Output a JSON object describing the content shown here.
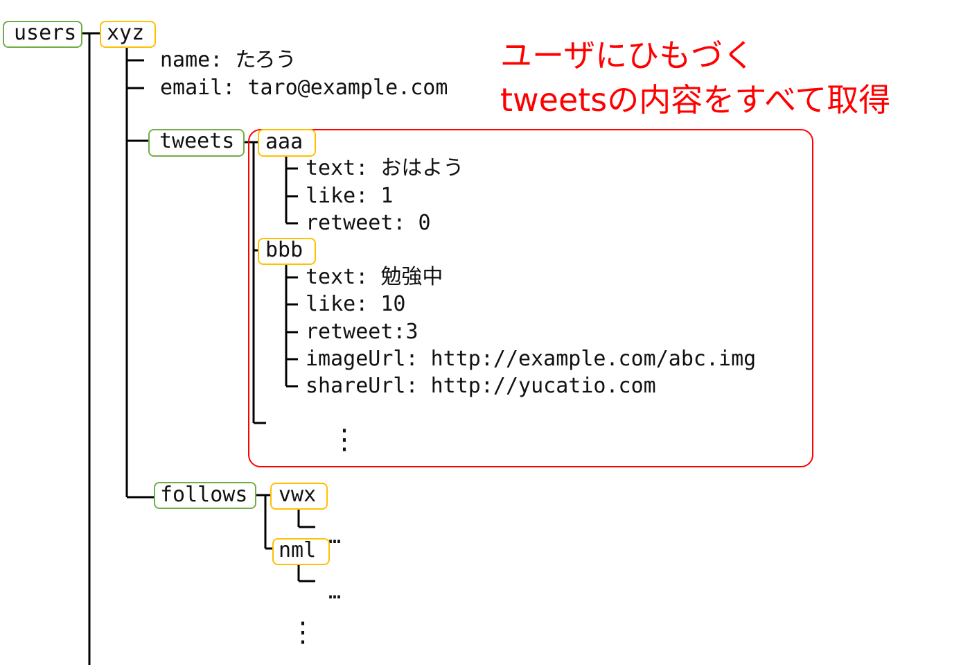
{
  "colors": {
    "collection": "#70ad47",
    "document": "#ffc000",
    "highlight": "#ff0000"
  },
  "annotation": {
    "line1": "ユーザにひもづく",
    "line2": "tweetsの内容をすべて取得"
  },
  "tree": {
    "users": "users",
    "xyz": "xyz",
    "name": "name: たろう",
    "email": "email: taro@example.com",
    "tweets": "tweets",
    "aaa": {
      "id": "aaa",
      "text": "text: おはよう",
      "like": "like: 1",
      "retweet": "retweet: 0"
    },
    "bbb": {
      "id": "bbb",
      "text": "text: 勉強中",
      "like": "like: 10",
      "retweet": "retweet:3",
      "imageUrl": "imageUrl: http://example.com/abc.img",
      "shareUrl": "shareUrl: http://yucatio.com"
    },
    "tweets_more": "⋮",
    "follows": "follows",
    "vwx": "vwx",
    "vwx_more": "…",
    "nml": "nml",
    "nml_more": "…",
    "follows_more": "⋮"
  }
}
